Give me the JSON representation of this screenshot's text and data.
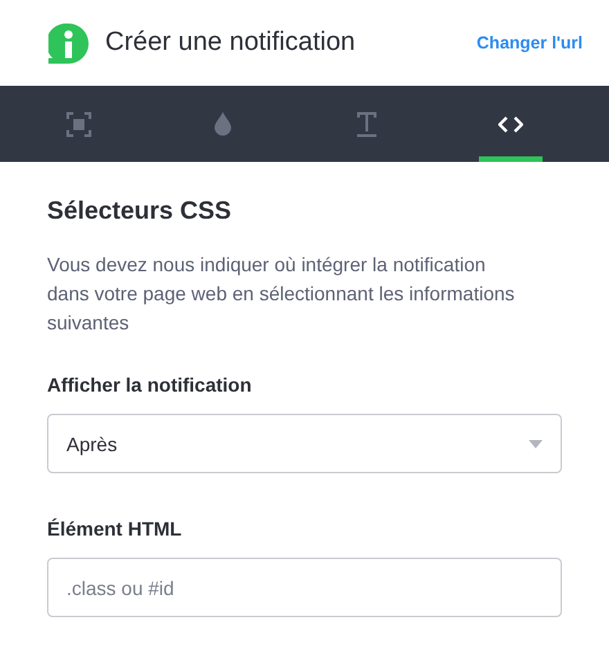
{
  "header": {
    "title": "Créer une notification",
    "link": "Changer l'url"
  },
  "tabs": [
    {
      "kind": "frame",
      "selected": false
    },
    {
      "kind": "drop",
      "selected": false
    },
    {
      "kind": "text",
      "selected": false
    },
    {
      "kind": "code",
      "selected": true
    }
  ],
  "section": {
    "title": "Sélecteurs CSS",
    "description": "Vous devez nous indiquer où intégrer la notification dans votre page web en sélectionnant les informations suivantes"
  },
  "fields": [
    {
      "kind": "select",
      "label": "Afficher la notification",
      "value": "Après"
    },
    {
      "kind": "input",
      "label": "Élément HTML",
      "placeholder": ".class ou #id"
    }
  ]
}
